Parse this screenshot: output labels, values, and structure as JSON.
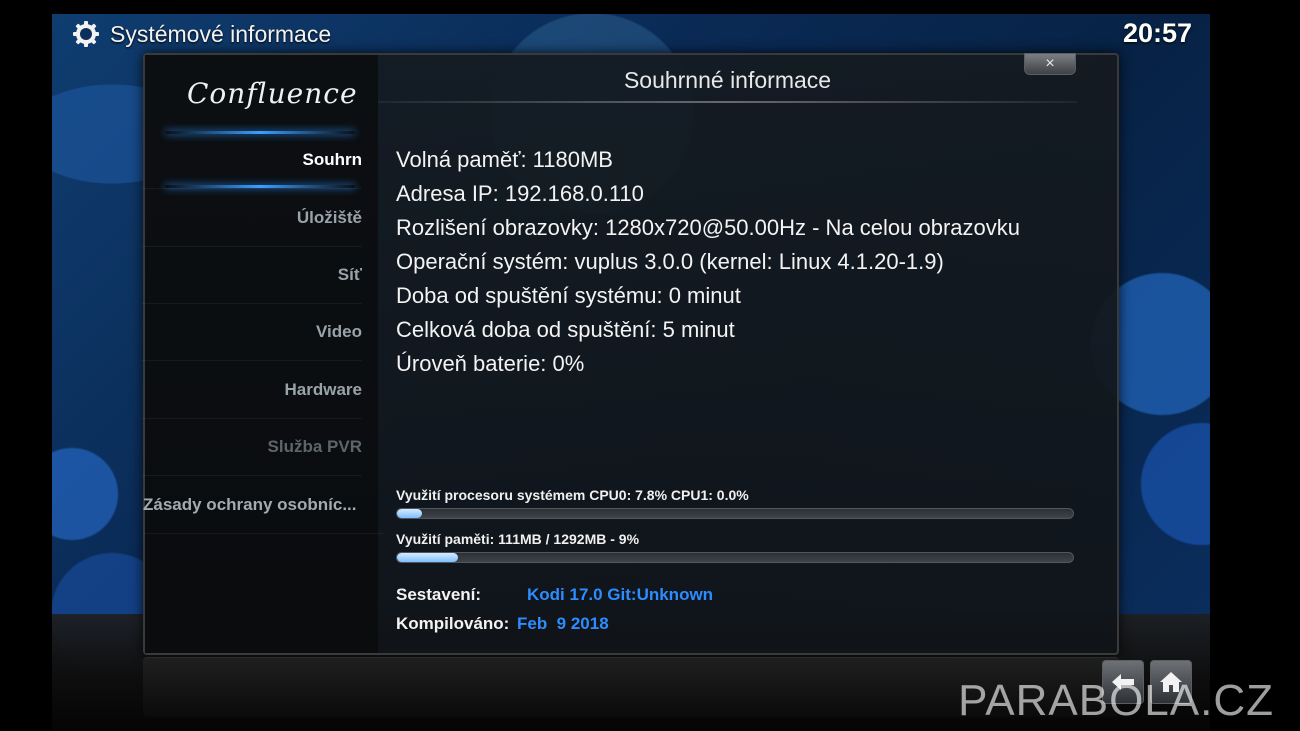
{
  "header": {
    "title": "Systémové informace",
    "clock": "20:57",
    "icon": "gear-icon"
  },
  "sidebar": {
    "logo": "Confluence",
    "items": [
      {
        "label": "Souhrn",
        "state": "active"
      },
      {
        "label": "Úložiště",
        "state": "normal"
      },
      {
        "label": "Síť",
        "state": "normal"
      },
      {
        "label": "Video",
        "state": "normal"
      },
      {
        "label": "Hardware",
        "state": "normal"
      },
      {
        "label": "Služba PVR",
        "state": "disabled"
      },
      {
        "label": "Zásady ochrany osobníc...",
        "state": "normal"
      }
    ]
  },
  "dialog": {
    "title": "Souhrnné informace",
    "close_label": "×",
    "info": [
      "Volná paměť: 1180MB",
      "Adresa IP: 192.168.0.110",
      "Rozlišení obrazovky: 1280x720@50.00Hz - Na celou obrazovku",
      "Operační systém: vuplus 3.0.0 (kernel: Linux 4.1.20-1.9)",
      "Doba od spuštění systému: 0 minut",
      "Celková doba od spuštění: 5 minut",
      "Úroveň baterie: 0%"
    ],
    "cpu": {
      "label": "Využití procesoru systémem CPU0: 7.8% CPU1: 0.0%",
      "percent": 3.7
    },
    "memory": {
      "label": "Využití paměti: 111MB / 1292MB - 9%",
      "percent": 9
    },
    "build": {
      "label": "Sestavení:",
      "value": "Kodi 17.0 Git:Unknown"
    },
    "compiled": {
      "label": "Kompilováno:",
      "value": "Feb  9 2018"
    }
  },
  "nav": {
    "back_icon": "back-arrow-icon",
    "home_icon": "home-icon"
  },
  "watermark": "PARABOLA.CZ",
  "colors": {
    "accent": "#2d8cff",
    "bar_fill": "#9fd0ff"
  }
}
